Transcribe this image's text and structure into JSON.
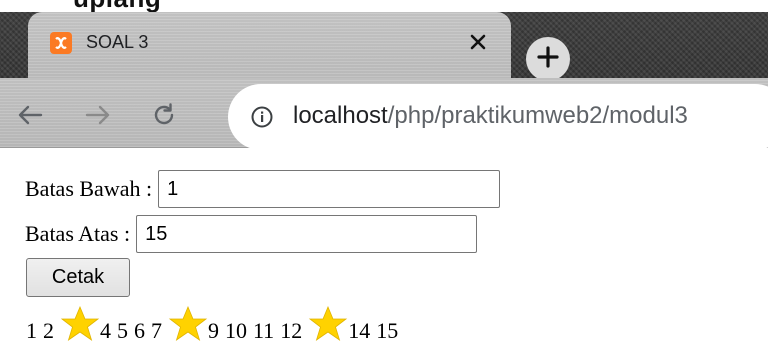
{
  "crop_text": "uplang",
  "browser": {
    "tab_title": "SOAL 3",
    "url_host": "localhost",
    "url_path": "/php/praktikumweb2/modul3"
  },
  "form": {
    "lower_label": "Batas Bawah :",
    "lower_value": "1",
    "upper_label": "Batas Atas :",
    "upper_value": "15",
    "submit_label": "Cetak"
  },
  "output": [
    {
      "type": "num",
      "text": "1"
    },
    {
      "type": "num",
      "text": "2"
    },
    {
      "type": "star"
    },
    {
      "type": "num",
      "text": "4"
    },
    {
      "type": "num",
      "text": "5"
    },
    {
      "type": "num",
      "text": "6"
    },
    {
      "type": "num",
      "text": "7"
    },
    {
      "type": "star"
    },
    {
      "type": "num",
      "text": "9"
    },
    {
      "type": "num",
      "text": "10"
    },
    {
      "type": "num",
      "text": "11"
    },
    {
      "type": "num",
      "text": "12"
    },
    {
      "type": "star"
    },
    {
      "type": "num",
      "text": "14"
    },
    {
      "type": "num",
      "text": "15"
    }
  ],
  "colors": {
    "star": "#ffd200",
    "favicon": "#fb7a24"
  }
}
